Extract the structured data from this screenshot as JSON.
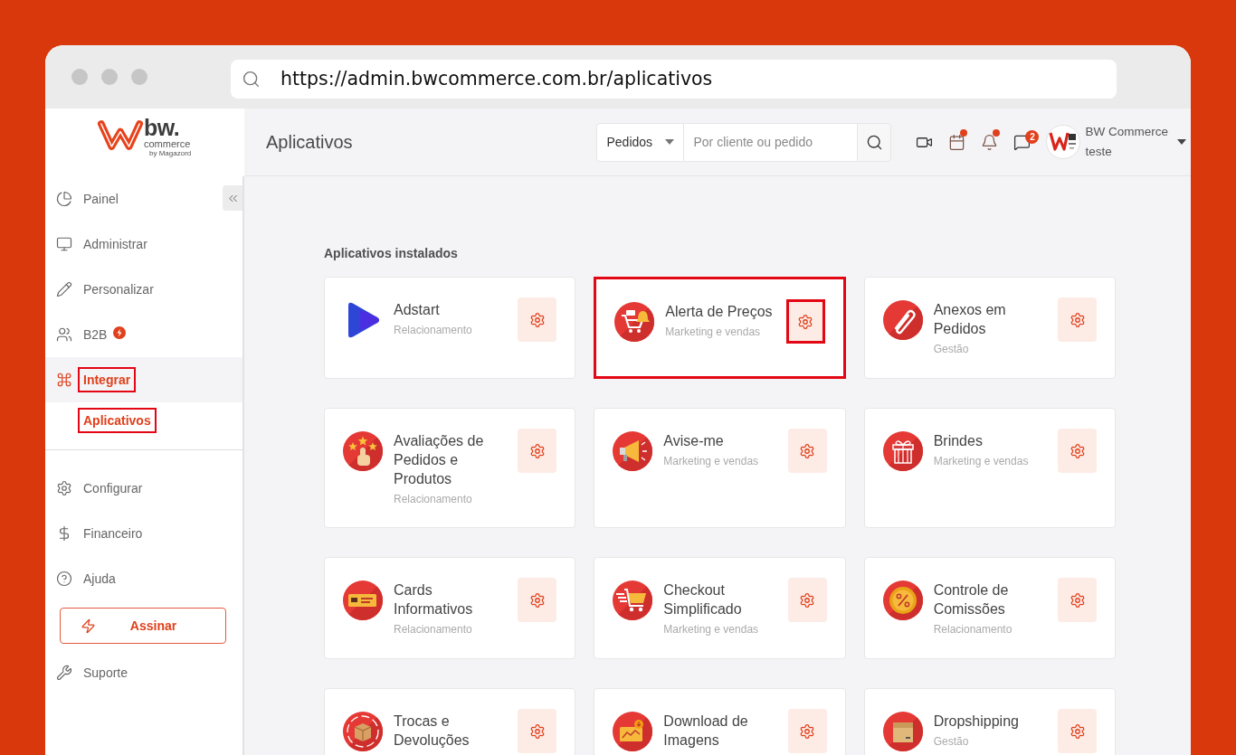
{
  "browser": {
    "url": "https://admin.bwcommerce.com.br/aplicativos"
  },
  "logo": {
    "wordmark": "bw.",
    "tagline": "commerce",
    "byline": "by Magazord"
  },
  "sidebar": {
    "items": [
      {
        "label": "Painel",
        "selected": false,
        "highlighted": false,
        "badge": false
      },
      {
        "label": "Administrar",
        "selected": false,
        "highlighted": false,
        "badge": false
      },
      {
        "label": "Personalizar",
        "selected": false,
        "highlighted": false,
        "badge": false
      },
      {
        "label": "B2B",
        "selected": false,
        "highlighted": false,
        "badge": true
      },
      {
        "label": "Integrar",
        "selected": true,
        "highlighted": true,
        "badge": false,
        "children": [
          {
            "label": "Aplicativos",
            "selected": true,
            "highlighted": true
          }
        ]
      }
    ],
    "bottom_items": [
      {
        "kind": "link",
        "label": "Configurar"
      },
      {
        "kind": "link",
        "label": "Financeiro"
      },
      {
        "kind": "link",
        "label": "Ajuda"
      },
      {
        "kind": "button",
        "label": "Assinar"
      },
      {
        "kind": "link",
        "label": "Suporte"
      }
    ]
  },
  "header": {
    "title": "Aplicativos",
    "search": {
      "scope": "Pedidos",
      "placeholder": "Por cliente ou pedido"
    },
    "icons": [
      {
        "dot": false
      },
      {
        "dot": true
      },
      {
        "dot": true
      },
      {
        "dot": false,
        "badge": "2"
      }
    ],
    "user": {
      "name": "BW Commerce",
      "subtitle": "teste"
    }
  },
  "section": {
    "title": "Aplicativos instalados"
  },
  "apps": [
    {
      "name": "Adstart",
      "category": "Relacionamento",
      "highlighted": false,
      "gear_highlighted": false
    },
    {
      "name": "Alerta de Preços",
      "category": "Marketing e vendas",
      "highlighted": true,
      "gear_highlighted": true
    },
    {
      "name": "Anexos em Pedidos",
      "category": "Gestão",
      "highlighted": false,
      "gear_highlighted": false
    },
    {
      "name": "Avaliações de Pedidos e Produtos",
      "category": "Relacionamento",
      "highlighted": false,
      "gear_highlighted": false
    },
    {
      "name": "Avise-me",
      "category": "Marketing e vendas",
      "highlighted": false,
      "gear_highlighted": false
    },
    {
      "name": "Brindes",
      "category": "Marketing e vendas",
      "highlighted": false,
      "gear_highlighted": false
    },
    {
      "name": "Cards Informativos",
      "category": "Relacionamento",
      "highlighted": false,
      "gear_highlighted": false
    },
    {
      "name": "Checkout Simplificado",
      "category": "Marketing e vendas",
      "highlighted": false,
      "gear_highlighted": false
    },
    {
      "name": "Controle de Comissões",
      "category": "Relacionamento",
      "highlighted": false,
      "gear_highlighted": false
    },
    {
      "name": "Trocas e Devoluções",
      "highlighted": false,
      "gear_highlighted": false
    },
    {
      "name": "Download de Imagens",
      "highlighted": false,
      "gear_highlighted": false
    },
    {
      "name": "Dropshipping",
      "category": "Gestão",
      "highlighted": false,
      "gear_highlighted": false
    }
  ]
}
